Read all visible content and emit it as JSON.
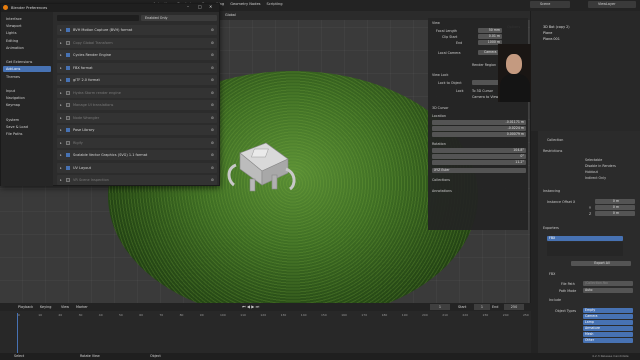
{
  "menu": [
    "Animation",
    "Rendering",
    "Compositing",
    "Geometry Nodes",
    "Scripting"
  ],
  "menu_active": "",
  "scene_field": "Scene",
  "viewlayer_field": "ViewLayer",
  "viewport": {
    "orientation_label": "Global",
    "options_label": "Options",
    "cursor_label": "3D Cursor"
  },
  "prefs": {
    "title": "Blender Preferences",
    "search_placeholder": "",
    "enabled_only_label": "Enabled Only",
    "sidebar": [
      "Interface",
      "Viewport",
      "Lights",
      "Editing",
      "Animation",
      "",
      "Get Extensions",
      "Add-ons",
      "Themes",
      "",
      "Input",
      "Navigation",
      "Keymap",
      "",
      "System",
      "Save & Load",
      "File Paths"
    ],
    "selected_index": 7,
    "addons": [
      {
        "label": "BVH Motion Capture (BVH) format",
        "enabled": true
      },
      {
        "label": "Copy Global Transform",
        "enabled": false
      },
      {
        "label": "Cycles Render Engine",
        "enabled": true
      },
      {
        "label": "FBX format",
        "enabled": true
      },
      {
        "label": "glTF 2.0 format",
        "enabled": true
      },
      {
        "label": "Hydra Storm render engine",
        "enabled": false
      },
      {
        "label": "Manage UI translations",
        "enabled": false
      },
      {
        "label": "Node Wrangler",
        "enabled": false
      },
      {
        "label": "Pose Library",
        "enabled": true
      },
      {
        "label": "Rigify",
        "enabled": false
      },
      {
        "label": "Scalable Vector Graphics (SVG) 1.1 format",
        "enabled": true
      },
      {
        "label": "UV Layout",
        "enabled": true
      },
      {
        "label": "VR Scene Inspection",
        "enabled": false
      }
    ]
  },
  "npanel": {
    "view_header": "View",
    "focal_label": "Focal Length",
    "focal_value": "50 mm",
    "clip_start_label": "Clip Start",
    "clip_start_value": "0.01 m",
    "end_label": "End",
    "end_value": "1000 m",
    "local_camera_label": "Local Camera",
    "camera_value": "Camera",
    "render_region_label": "Render Region",
    "view_lock_header": "View Lock",
    "lock_object_label": "Lock to Object",
    "lock_label": "Lock",
    "to_cursor_label": "To 3D Cursor",
    "camera_to_view_label": "Camera to View",
    "cursor_header": "3D Cursor",
    "location_label": "Location",
    "x_label": "X",
    "x_value": "-0.01171 m",
    "y_label": "Y",
    "y_value": "-0.0224 m",
    "z_label": "Z",
    "z_value": "0.00079 m",
    "rotation_label": "Rotation",
    "rx_value": "104.8°",
    "ry_value": "0°",
    "rz_value": "11.2°",
    "xyz_euler": "XYZ Euler",
    "collections_label": "Collections",
    "annotations_label": "Annotations"
  },
  "outliner": {
    "items": [
      "3D Bot (copy 2)",
      "Plane",
      "Plane.001"
    ]
  },
  "properties": {
    "header": "Collection",
    "restrictions": "Restrictions",
    "selectable": "Selectable",
    "disable_renders": "Disable in Renders",
    "holdout": "Holdout",
    "indirect_only": "Indirect Only",
    "instancing": "Instancing",
    "instance_offset": "Instance Offset X",
    "ox": "0 m",
    "oy": "0 m",
    "oz": "0 m",
    "oy_label": "Y",
    "oz_label": "Z",
    "exporters": "Exporters",
    "fbx": "FBX",
    "export_all": "Export All",
    "fbx_sub": "FBX",
    "file_path_label": "File Path",
    "file_path_value": "/Collection.fbx",
    "path_mode_label": "Path Mode",
    "path_mode_value": "Auto",
    "include": "Include",
    "object_types_label": "Object Types",
    "types": [
      "Empty",
      "Camera",
      "Lamp",
      "Armature",
      "Mesh",
      "Other"
    ]
  },
  "timeline": {
    "playback": "Playback",
    "keying": "Keying",
    "view": "View",
    "marker": "Marker",
    "frame": "1",
    "start_label": "Start",
    "start": "1",
    "end_label": "End",
    "end": "250",
    "ticks": [
      "0",
      "10",
      "20",
      "30",
      "40",
      "50",
      "60",
      "70",
      "80",
      "90",
      "100",
      "110",
      "120",
      "130",
      "140",
      "150",
      "160",
      "170",
      "180",
      "190",
      "200",
      "210",
      "220",
      "230",
      "240",
      "250"
    ]
  },
  "status": {
    "left": "Select",
    "mid": "Rotate View",
    "right": "Object",
    "version": "4.2.3 Release Candidate"
  }
}
